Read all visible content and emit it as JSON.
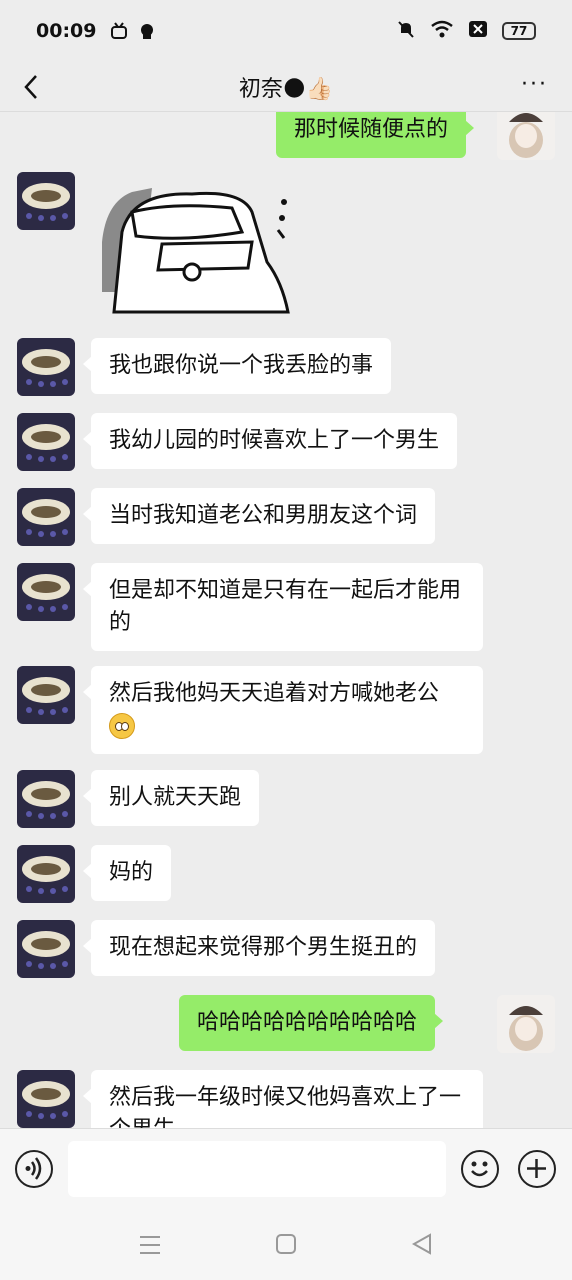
{
  "status_bar": {
    "time": "00:09",
    "battery": "77"
  },
  "header": {
    "title": "初奈🌑👍🏻",
    "more_label": "···"
  },
  "messages": [
    {
      "side": "right",
      "text": "那时候随便点的"
    },
    {
      "side": "left",
      "text": "",
      "sticker": "sticker-hand-over-face"
    },
    {
      "side": "left",
      "text": "我也跟你说一个我丢脸的事"
    },
    {
      "side": "left",
      "text": "我幼儿园的时候喜欢上了一个男生"
    },
    {
      "side": "left",
      "text": "当时我知道老公和男朋友这个词"
    },
    {
      "side": "left",
      "text": "但是却不知道是只有在一起后才能用的"
    },
    {
      "side": "left",
      "text": "然后我他妈天天追着对方喊她老公",
      "emoji": "flushed-face-emoji"
    },
    {
      "side": "left",
      "text": "别人就天天跑"
    },
    {
      "side": "left",
      "text": "妈的"
    },
    {
      "side": "left",
      "text": "现在想起来觉得那个男生挺丑的"
    },
    {
      "side": "right",
      "text": "哈哈哈哈哈哈哈哈哈哈"
    },
    {
      "side": "left",
      "text": "然后我一年级时候又他妈喜欢上了一个男生"
    }
  ],
  "colors": {
    "background": "#ededed",
    "my_bubble": "#95ec69",
    "their_bubble": "#ffffff"
  }
}
